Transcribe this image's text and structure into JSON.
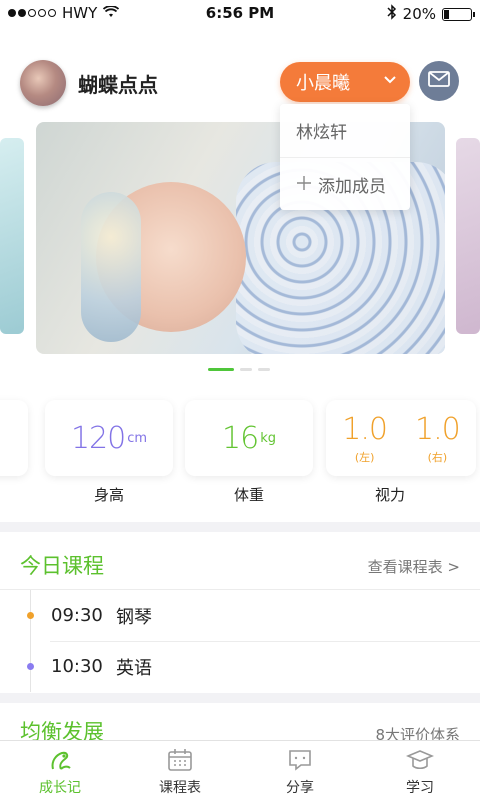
{
  "status_bar": {
    "carrier": "HWY",
    "time": "6:56 PM",
    "battery": "20%"
  },
  "header": {
    "profile_name": "蝴蝶点点",
    "selected_member": "小晨曦",
    "dropdown_items": [
      "林炫轩",
      "添加成员"
    ]
  },
  "carousel": {
    "page_count": 3,
    "active_index": 0
  },
  "metrics": {
    "height": {
      "value": "120",
      "unit": "cm",
      "label": "身高"
    },
    "weight": {
      "value": "16",
      "unit": "kg",
      "label": "体重"
    },
    "vision": {
      "left_value": "1.0",
      "left_side": "(左)",
      "right_value": "1.0",
      "right_side": "(右)",
      "label": "视力"
    }
  },
  "today_courses": {
    "title": "今日课程",
    "link": "查看课程表 >",
    "items": [
      {
        "time": "09:30",
        "name": "钢琴",
        "dot_color": "#f0a12b"
      },
      {
        "time": "10:30",
        "name": "英语",
        "dot_color": "#8a7cf0"
      }
    ]
  },
  "balanced": {
    "title": "均衡发展",
    "link": "8大评价体系"
  },
  "tabs": [
    {
      "label": "成长记",
      "icon": "growth-icon",
      "active": true
    },
    {
      "label": "课程表",
      "icon": "calendar-icon",
      "active": false
    },
    {
      "label": "分享",
      "icon": "chat-bubble-icon",
      "active": false
    },
    {
      "label": "学习",
      "icon": "graduation-cap-icon",
      "active": false
    }
  ],
  "colors": {
    "accent_green": "#5cc12e",
    "member_select": "#f47b3a",
    "mail_button": "#6e7d97",
    "height_value": "#8273e6",
    "weight_value": "#63c433",
    "vision_value": "#f0a12b"
  }
}
